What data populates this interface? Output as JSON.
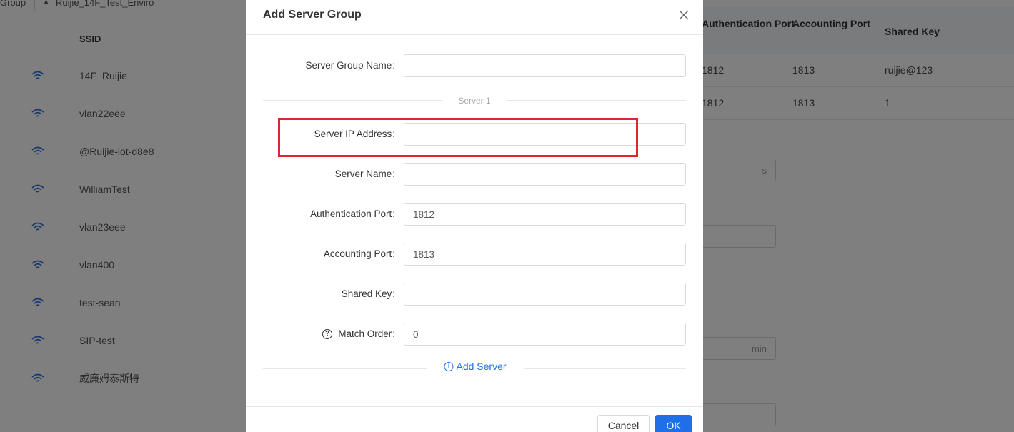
{
  "background": {
    "group_label": "Group",
    "group_select_value": "Ruijie_14F_Test_Enviro",
    "ssid_header": "SSID",
    "ssids": [
      "14F_Ruijie",
      "vlan22eee",
      "@Ruijie-iot-d8e8",
      "WilliamTest",
      "vlan23eee",
      "vlan400",
      "test-sean",
      "SIP-test",
      "威廉姆泰斯特"
    ],
    "table": {
      "headers": [
        "Authentication Port",
        "Accounting Port",
        "Shared Key"
      ],
      "rows": [
        [
          "1812",
          "1813",
          "ruijie@123"
        ],
        [
          "1812",
          "1813",
          "1"
        ]
      ]
    },
    "unit_seconds": "s",
    "unit_minutes": "min"
  },
  "modal": {
    "title": "Add Server Group",
    "fields": {
      "server_group_name": {
        "label": "Server Group Name",
        "value": ""
      },
      "server_ip": {
        "label": "Server IP Address",
        "value": ""
      },
      "server_name": {
        "label": "Server Name",
        "value": ""
      },
      "auth_port": {
        "label": "Authentication Port",
        "value": "1812"
      },
      "acct_port": {
        "label": "Accounting Port",
        "value": "1813"
      },
      "shared_key": {
        "label": "Shared Key",
        "value": ""
      },
      "match_order": {
        "label": "Match Order",
        "value": "0"
      }
    },
    "colon": ":",
    "section_label": "Server 1",
    "add_server_label": "Add Server",
    "cancel_label": "Cancel",
    "ok_label": "OK"
  },
  "colors": {
    "accent": "#1e6fe8",
    "highlight": "#e0262c",
    "wifi_icon": "#2e6fd6"
  },
  "icons": {
    "close": "close-icon",
    "help": "question-circle-icon",
    "add": "plus-circle-icon",
    "wifi": "wifi-icon"
  }
}
